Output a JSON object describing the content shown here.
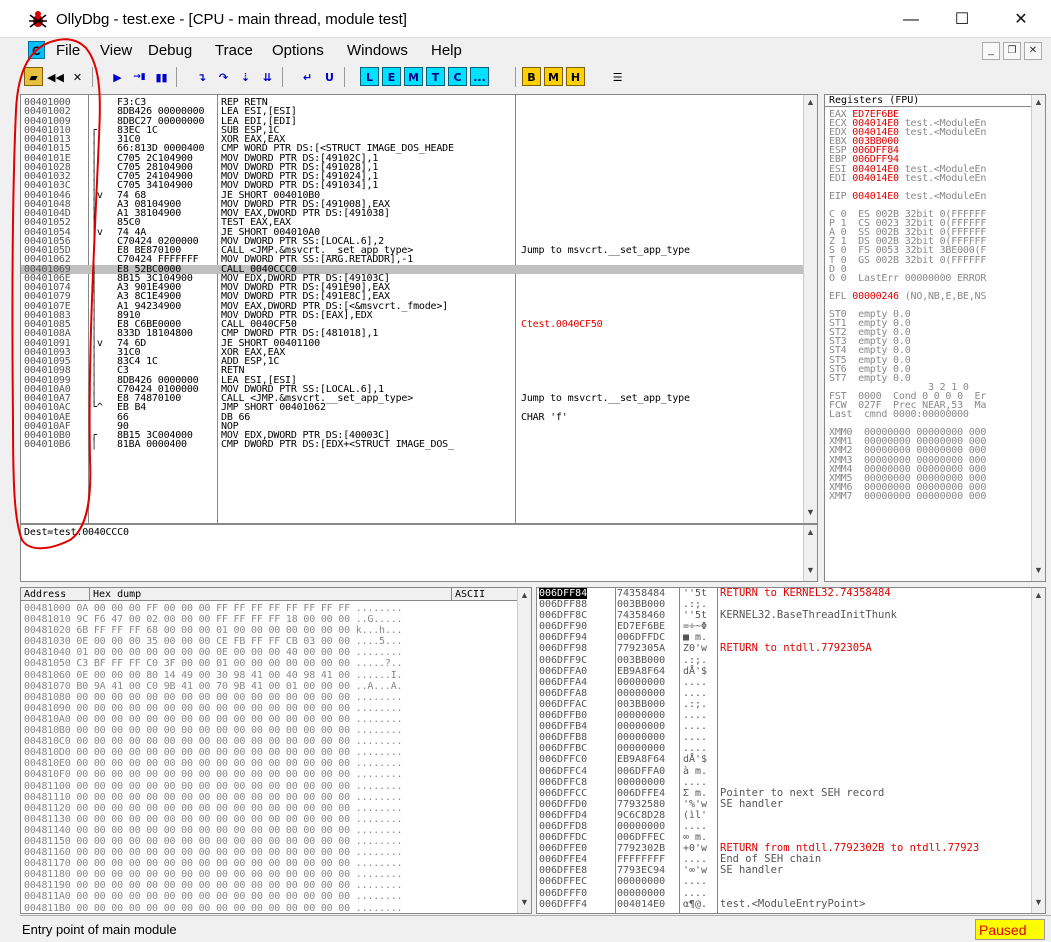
{
  "window": {
    "title": "OllyDbg - test.exe - [CPU - main thread, module test]",
    "minimize": "—",
    "maximize": "☐",
    "close": "✕",
    "app_icon": "bug-icon"
  },
  "menu": [
    "File",
    "View",
    "Debug",
    "Trace",
    "Options",
    "Windows",
    "Help"
  ],
  "mdi_icon_label": "C",
  "toolbar": {
    "group1": [
      "open-icon",
      "restart-icon",
      "close-icon"
    ],
    "group2": [
      "▶",
      "→▮",
      "▮▮"
    ],
    "group3": [
      "step-into-icon",
      "step-over-icon",
      "trace-into-icon",
      "trace-over-icon"
    ],
    "group4": [
      "execute-till-return-icon",
      "go-to-user-code-icon"
    ],
    "letters_cyan": [
      "L",
      "E",
      "M",
      "T",
      "C",
      "..."
    ],
    "letters_yellow": [
      "B",
      "M",
      "H"
    ],
    "list_icon": "list-icon"
  },
  "disasm": [
    {
      "addr": "00401000",
      "br": "",
      "hex": "F3:C3",
      "dis": "REP RETN",
      "com": ""
    },
    {
      "addr": "00401002",
      "br": "",
      "hex": "8DB426 00000000",
      "dis": "LEA ESI,[ESI]",
      "com": ""
    },
    {
      "addr": "00401009",
      "br": "",
      "hex": "8DBC27 00000000",
      "dis": "LEA EDI,[EDI]",
      "com": ""
    },
    {
      "addr": "00401010",
      "br": "┌",
      "hex": "83EC 1C",
      "dis": "SUB ESP,1C",
      "com": ""
    },
    {
      "addr": "00401013",
      "br": "│",
      "hex": "31C0",
      "dis": "XOR EAX,EAX",
      "com": ""
    },
    {
      "addr": "00401015",
      "br": "│",
      "hex": "66:813D 0000400",
      "dis": "CMP WORD PTR DS:[<STRUCT IMAGE_DOS_HEADE",
      "com": ""
    },
    {
      "addr": "0040101E",
      "br": "│",
      "hex": "C705 2C104900",
      "dis": "MOV DWORD PTR DS:[49102C],1",
      "com": ""
    },
    {
      "addr": "00401028",
      "br": "│",
      "hex": "C705 28104900",
      "dis": "MOV DWORD PTR DS:[491028],1",
      "com": ""
    },
    {
      "addr": "00401032",
      "br": "│",
      "hex": "C705 24104900",
      "dis": "MOV DWORD PTR DS:[491024],1",
      "com": ""
    },
    {
      "addr": "0040103C",
      "br": "│",
      "hex": "C705 34104900",
      "dis": "MOV DWORD PTR DS:[491034],1",
      "com": ""
    },
    {
      "addr": "00401046",
      "br": "│v",
      "hex": "74 68",
      "dis": "JE SHORT 004010B0",
      "com": ""
    },
    {
      "addr": "00401048",
      "br": "│",
      "hex": "A3 08104900",
      "dis": "MOV DWORD PTR DS:[491008],EAX",
      "com": ""
    },
    {
      "addr": "0040104D",
      "br": "│",
      "hex": "A1 38104900",
      "dis": "MOV EAX,DWORD PTR DS:[491038]",
      "com": ""
    },
    {
      "addr": "00401052",
      "br": "│",
      "hex": "85C0",
      "dis": "TEST EAX,EAX",
      "com": ""
    },
    {
      "addr": "00401054",
      "br": "│v",
      "hex": "74 4A",
      "dis": "JE SHORT 004010A0",
      "com": ""
    },
    {
      "addr": "00401056",
      "br": "│",
      "hex": "C70424 0200000",
      "dis": "MOV DWORD PTR SS:[LOCAL.6],2",
      "com": ""
    },
    {
      "addr": "0040105D",
      "br": "│",
      "hex": "E8 BE870100",
      "dis": "CALL <JMP.&msvcrt.__set_app_type>",
      "com": "Jump to msvcrt.__set_app_type"
    },
    {
      "addr": "00401062",
      "br": "│",
      "hex": "C70424 FFFFFFF",
      "dis": "MOV DWORD PTR SS:[ARG.RETADDR],-1",
      "com": ""
    },
    {
      "addr": "00401069",
      "br": "│",
      "hex": "E8 52BC0000",
      "dis": "CALL 0040CCC0",
      "com": "",
      "sel": true
    },
    {
      "addr": "0040106E",
      "br": "│",
      "hex": "8B15 3C104900",
      "dis": "MOV EDX,DWORD PTR DS:[49103C]",
      "com": ""
    },
    {
      "addr": "00401074",
      "br": "│",
      "hex": "A3 901E4900",
      "dis": "MOV DWORD PTR DS:[491E90],EAX",
      "com": ""
    },
    {
      "addr": "00401079",
      "br": "│",
      "hex": "A3 8C1E4900",
      "dis": "MOV DWORD PTR DS:[491E8C],EAX",
      "com": ""
    },
    {
      "addr": "0040107E",
      "br": "│",
      "hex": "A1 94234900",
      "dis": "MOV EAX,DWORD PTR DS:[<&msvcrt._fmode>]",
      "com": ""
    },
    {
      "addr": "00401083",
      "br": "│",
      "hex": "8910",
      "dis": "MOV DWORD PTR DS:[EAX],EDX",
      "com": ""
    },
    {
      "addr": "00401085",
      "br": "│",
      "hex": "E8 C6BE0000",
      "dis": "CALL 0040CF50",
      "com": "Ctest.0040CF50",
      "red": true
    },
    {
      "addr": "0040108A",
      "br": "│",
      "hex": "833D 18104800",
      "dis": "CMP DWORD PTR DS:[481018],1",
      "com": ""
    },
    {
      "addr": "00401091",
      "br": "│v",
      "hex": "74 6D",
      "dis": "JE SHORT 00401100",
      "com": ""
    },
    {
      "addr": "00401093",
      "br": "│",
      "hex": "31C0",
      "dis": "XOR EAX,EAX",
      "com": ""
    },
    {
      "addr": "00401095",
      "br": "│",
      "hex": "83C4 1C",
      "dis": "ADD ESP,1C",
      "com": ""
    },
    {
      "addr": "00401098",
      "br": "│",
      "hex": "C3",
      "dis": "RETN",
      "com": ""
    },
    {
      "addr": "00401099",
      "br": "│",
      "hex": "8DB426 0000000",
      "dis": "LEA ESI,[ESI]",
      "com": ""
    },
    {
      "addr": "004010A0",
      "br": "│",
      "hex": "C70424 0100000",
      "dis": "MOV DWORD PTR SS:[LOCAL.6],1",
      "com": ""
    },
    {
      "addr": "004010A7",
      "br": "│",
      "hex": "E8 74870100",
      "dis": "CALL <JMP.&msvcrt.__set_app_type>",
      "com": "Jump to msvcrt.__set_app_type"
    },
    {
      "addr": "004010AC",
      "br": "└^",
      "hex": "EB B4",
      "dis": "JMP SHORT 00401062",
      "com": ""
    },
    {
      "addr": "004010AE",
      "br": "",
      "hex": "66",
      "dis": "DB 66",
      "com": "CHAR 'f'"
    },
    {
      "addr": "004010AF",
      "br": "",
      "hex": "90",
      "dis": "NOP",
      "com": ""
    },
    {
      "addr": "004010B0",
      "br": "┌",
      "hex": "8B15 3C004000",
      "dis": "MOV EDX,DWORD PTR DS:[40003C]",
      "com": ""
    },
    {
      "addr": "004010B6",
      "br": "│",
      "hex": "81BA 0000400",
      "dis": "CMP DWORD PTR DS:[EDX+<STRUCT IMAGE_DOS_",
      "com": ""
    }
  ],
  "info_line": "Dest=test.0040CCC0",
  "registers": {
    "header": "Registers (FPU)",
    "rows": [
      {
        "k": "EAX",
        "v": "ED7EF6BE",
        "t": ""
      },
      {
        "k": "ECX",
        "v": "004014E0",
        "t": "test.<ModuleEn"
      },
      {
        "k": "EDX",
        "v": "004014E0",
        "t": "test.<ModuleEn"
      },
      {
        "k": "EBX",
        "v": "003BB000",
        "t": ""
      },
      {
        "k": "ESP",
        "v": "006DFF84",
        "t": ""
      },
      {
        "k": "EBP",
        "v": "006DFF94",
        "t": ""
      },
      {
        "k": "ESI",
        "v": "004014E0",
        "t": "test.<ModuleEn"
      },
      {
        "k": "EDI",
        "v": "004014E0",
        "t": "test.<ModuleEn"
      },
      {
        "k": "",
        "v": "",
        "t": ""
      },
      {
        "k": "EIP",
        "v": "004014E0",
        "t": "test.<ModuleEn"
      },
      {
        "k": "",
        "v": "",
        "t": ""
      },
      {
        "k": "C 0",
        "v": "",
        "t": "ES 002B 32bit 0(FFFFFF"
      },
      {
        "k": "P 1",
        "v": "",
        "t": "CS 0023 32bit 0(FFFFFF"
      },
      {
        "k": "A 0",
        "v": "",
        "t": "SS 002B 32bit 0(FFFFFF"
      },
      {
        "k": "Z 1",
        "v": "",
        "t": "DS 002B 32bit 0(FFFFFF"
      },
      {
        "k": "S 0",
        "v": "",
        "t": "FS 0053 32bit 3BE000(F"
      },
      {
        "k": "T 0",
        "v": "",
        "t": "GS 002B 32bit 0(FFFFFF"
      },
      {
        "k": "D 0",
        "v": "",
        "t": ""
      },
      {
        "k": "O 0",
        "v": "",
        "t": "LastErr 00000000 ERROR"
      },
      {
        "k": "",
        "v": "",
        "t": ""
      },
      {
        "k": "EFL",
        "v": "00000246",
        "t": "(NO,NB,E,BE,NS"
      },
      {
        "k": "",
        "v": "",
        "t": ""
      },
      {
        "k": "ST0",
        "v": "",
        "t": "empty 0.0"
      },
      {
        "k": "ST1",
        "v": "",
        "t": "empty 0.0"
      },
      {
        "k": "ST2",
        "v": "",
        "t": "empty 0.0"
      },
      {
        "k": "ST3",
        "v": "",
        "t": "empty 0.0"
      },
      {
        "k": "ST4",
        "v": "",
        "t": "empty 0.0"
      },
      {
        "k": "ST5",
        "v": "",
        "t": "empty 0.0"
      },
      {
        "k": "ST6",
        "v": "",
        "t": "empty 0.0"
      },
      {
        "k": "ST7",
        "v": "",
        "t": "empty 0.0"
      },
      {
        "k": "",
        "v": "",
        "t": "               3 2 1 0"
      },
      {
        "k": "FST",
        "v": "",
        "t": "0000  Cond 0 0 0 0  Er"
      },
      {
        "k": "FCW",
        "v": "",
        "t": "027F  Prec NEAR,53  Ma"
      },
      {
        "k": "Last",
        "v": "",
        "t": "cmnd 0000:00000000"
      },
      {
        "k": "",
        "v": "",
        "t": ""
      },
      {
        "k": "XMM0",
        "v": "",
        "t": "00000000 00000000 000"
      },
      {
        "k": "XMM1",
        "v": "",
        "t": "00000000 00000000 000"
      },
      {
        "k": "XMM2",
        "v": "",
        "t": "00000000 00000000 000"
      },
      {
        "k": "XMM3",
        "v": "",
        "t": "00000000 00000000 000"
      },
      {
        "k": "XMM4",
        "v": "",
        "t": "00000000 00000000 000"
      },
      {
        "k": "XMM5",
        "v": "",
        "t": "00000000 00000000 000"
      },
      {
        "k": "XMM6",
        "v": "",
        "t": "00000000 00000000 000"
      },
      {
        "k": "XMM7",
        "v": "",
        "t": "00000000 00000000 000"
      }
    ]
  },
  "dump": {
    "headers": {
      "address": "Address",
      "hex": "Hex dump",
      "ascii": "ASCII"
    },
    "rows": [
      "00481000 0A 00 00 00 FF 00 00 00 FF FF FF FF FF FF FF FF ........",
      "00481010 9C F6 47 00 02 00 00 00 FF FF FF FF 18 00 00 00 ..G.....",
      "00481020 6B FF FF FF 68 00 00 00 01 00 00 00 00 00 00 00 k...h...",
      "00481030 0E 00 00 00 35 00 00 00 CE FB FF FF CB 03 00 00 ....5...",
      "00481040 01 00 00 00 00 00 00 00 0E 00 00 00 40 00 00 00 ........",
      "00481050 C3 BF FF FF C0 3F 00 00 01 00 00 00 00 00 00 00 .....?..",
      "00481060 0E 00 00 00 80 14 49 00 30 98 41 00 40 98 41 00 ......I.",
      "00481070 B0 9A 41 00 C0 9B 41 00 70 9B 41 00 01 00 00 00 ..A...A.",
      "00481080 00 00 00 00 00 00 00 00 00 00 00 00 00 00 00 00 ........",
      "00481090 00 00 00 00 00 00 00 00 00 00 00 00 00 00 00 00 ........",
      "004810A0 00 00 00 00 00 00 00 00 00 00 00 00 00 00 00 00 ........",
      "004810B0 00 00 00 00 00 00 00 00 00 00 00 00 00 00 00 00 ........",
      "004810C0 00 00 00 00 00 00 00 00 00 00 00 00 00 00 00 00 ........",
      "004810D0 00 00 00 00 00 00 00 00 00 00 00 00 00 00 00 00 ........",
      "004810E0 00 00 00 00 00 00 00 00 00 00 00 00 00 00 00 00 ........",
      "004810F0 00 00 00 00 00 00 00 00 00 00 00 00 00 00 00 00 ........",
      "00481100 00 00 00 00 00 00 00 00 00 00 00 00 00 00 00 00 ........",
      "00481110 00 00 00 00 00 00 00 00 00 00 00 00 00 00 00 00 ........",
      "00481120 00 00 00 00 00 00 00 00 00 00 00 00 00 00 00 00 ........",
      "00481130 00 00 00 00 00 00 00 00 00 00 00 00 00 00 00 00 ........",
      "00481140 00 00 00 00 00 00 00 00 00 00 00 00 00 00 00 00 ........",
      "00481150 00 00 00 00 00 00 00 00 00 00 00 00 00 00 00 00 ........",
      "00481160 00 00 00 00 00 00 00 00 00 00 00 00 00 00 00 00 ........",
      "00481170 00 00 00 00 00 00 00 00 00 00 00 00 00 00 00 00 ........",
      "00481180 00 00 00 00 00 00 00 00 00 00 00 00 00 00 00 00 ........",
      "00481190 00 00 00 00 00 00 00 00 00 00 00 00 00 00 00 00 ........",
      "004811A0 00 00 00 00 00 00 00 00 00 00 00 00 00 00 00 00 ........",
      "004811B0 00 00 00 00 00 00 00 00 00 00 00 00 00 00 00 00 ........"
    ]
  },
  "stack": [
    {
      "addr": "006DFF84",
      "val": "74358484",
      "asc": "''5t",
      "com": "RETURN to KERNEL32.74358484",
      "hl": true,
      "red": true
    },
    {
      "addr": "006DFF88",
      "val": "003BB000",
      "asc": ".:;.",
      "com": ""
    },
    {
      "addr": "006DFF8C",
      "val": "74358460",
      "asc": "''5t",
      "com": "KERNEL32.BaseThreadInitThunk"
    },
    {
      "addr": "006DFF90",
      "val": "ED7EF6BE",
      "asc": "=÷~Φ",
      "com": ""
    },
    {
      "addr": "006DFF94",
      "val": "006DFFDC",
      "asc": "■ m.",
      "com": ""
    },
    {
      "addr": "006DFF98",
      "val": "7792305A",
      "asc": "Z0'w",
      "com": "RETURN to ntdll.7792305A",
      "red": true
    },
    {
      "addr": "006DFF9C",
      "val": "003BB000",
      "asc": ".:;.",
      "com": ""
    },
    {
      "addr": "006DFFA0",
      "val": "EB9A8F64",
      "asc": "dÅ'$",
      "com": ""
    },
    {
      "addr": "006DFFA4",
      "val": "00000000",
      "asc": "....",
      "com": ""
    },
    {
      "addr": "006DFFA8",
      "val": "00000000",
      "asc": "....",
      "com": ""
    },
    {
      "addr": "006DFFAC",
      "val": "003BB000",
      "asc": ".:;.",
      "com": ""
    },
    {
      "addr": "006DFFB0",
      "val": "00000000",
      "asc": "....",
      "com": ""
    },
    {
      "addr": "006DFFB4",
      "val": "00000000",
      "asc": "....",
      "com": ""
    },
    {
      "addr": "006DFFB8",
      "val": "00000000",
      "asc": "....",
      "com": ""
    },
    {
      "addr": "006DFFBC",
      "val": "00000000",
      "asc": "....",
      "com": ""
    },
    {
      "addr": "006DFFC0",
      "val": "EB9A8F64",
      "asc": "dÅ'$",
      "com": ""
    },
    {
      "addr": "006DFFC4",
      "val": "006DFFA0",
      "asc": "à m.",
      "com": ""
    },
    {
      "addr": "006DFFC8",
      "val": "00000000",
      "asc": "....",
      "com": ""
    },
    {
      "addr": "006DFFCC",
      "val": "006DFFE4",
      "asc": "Σ m.",
      "com": "Pointer to next SEH record"
    },
    {
      "addr": "006DFFD0",
      "val": "77932580",
      "asc": "'%'w",
      "com": "SE handler"
    },
    {
      "addr": "006DFFD4",
      "val": "9C6C8D28",
      "asc": "(ìl'",
      "com": ""
    },
    {
      "addr": "006DFFD8",
      "val": "00000000",
      "asc": "....",
      "com": ""
    },
    {
      "addr": "006DFFDC",
      "val": "006DFFEC",
      "asc": "∞ m.",
      "com": ""
    },
    {
      "addr": "006DFFE0",
      "val": "7792302B",
      "asc": "+0'w",
      "com": "RETURN from ntdll.7792302B to ntdll.77923",
      "red": true
    },
    {
      "addr": "006DFFE4",
      "val": "FFFFFFFF",
      "asc": "....",
      "com": "End of SEH chain"
    },
    {
      "addr": "006DFFE8",
      "val": "7793EC94",
      "asc": "'∞'w",
      "com": "SE handler"
    },
    {
      "addr": "006DFFEC",
      "val": "00000000",
      "asc": "....",
      "com": ""
    },
    {
      "addr": "006DFFF0",
      "val": "00000000",
      "asc": "....",
      "com": ""
    },
    {
      "addr": "006DFFF4",
      "val": "004014E0",
      "asc": "α¶@.",
      "com": "test.<ModuleEntryPoint>"
    }
  ],
  "status": {
    "text": "Entry point of main module",
    "state": "Paused"
  },
  "colors": {
    "annotation": "#e00000",
    "highlight_red": "#e00000",
    "paused_bg": "#ffff00"
  }
}
